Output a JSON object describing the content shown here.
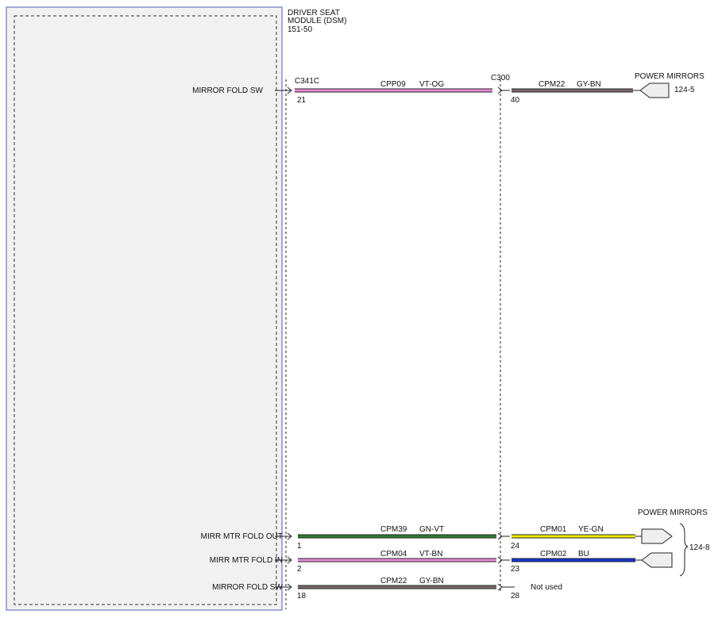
{
  "module": {
    "name_line1": "DRIVER SEAT",
    "name_line2": "MODULE (DSM)",
    "ref": "151-50"
  },
  "connectors": {
    "left": "C341C",
    "middle": "C300"
  },
  "destinations": {
    "top": {
      "name": "POWER MIRRORS",
      "ref": "124-5"
    },
    "bottom": {
      "name": "POWER MIRRORS",
      "ref": "124-8"
    }
  },
  "circuits": [
    {
      "signal": "MIRROR FOLD SW",
      "pin_left": "21",
      "seg1": {
        "circuit": "CPP09",
        "color_code": "VT-OG"
      },
      "pin_mid": "40",
      "seg2": {
        "circuit": "CPM22",
        "color_code": "GY-BN"
      }
    },
    {
      "signal": "MIRR MTR FOLD OUT",
      "pin_left": "1",
      "seg1": {
        "circuit": "CPM39",
        "color_code": "GN-VT"
      },
      "pin_mid": "24",
      "seg2": {
        "circuit": "CPM01",
        "color_code": "YE-GN"
      }
    },
    {
      "signal": "MIRR MTR FOLD IN",
      "pin_left": "2",
      "seg1": {
        "circuit": "CPM04",
        "color_code": "VT-BN"
      },
      "pin_mid": "23",
      "seg2": {
        "circuit": "CPM02",
        "color_code": "BU"
      }
    },
    {
      "signal": "MIRROR FOLD SW",
      "pin_left": "18",
      "seg1": {
        "circuit": "CPM22",
        "color_code": "GY-BN"
      },
      "pin_mid": "28",
      "seg2": {
        "note": "Not used"
      }
    }
  ],
  "colors": {
    "module_border": "#6b74c8",
    "module_fill": "#f1f1f1",
    "wire_pink": "#e98bd6",
    "wire_gray_brown": "#7a6a66",
    "wire_green": "#2e7d32",
    "wire_yellow": "#f2ee00",
    "wire_blue": "#1436d6",
    "pin_fill": "#eeeeee"
  }
}
